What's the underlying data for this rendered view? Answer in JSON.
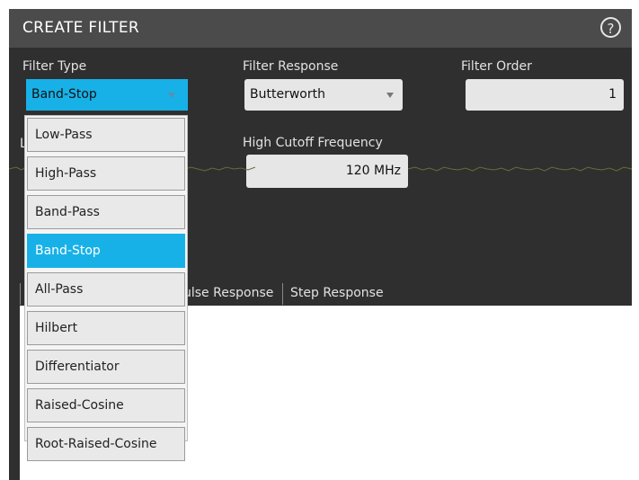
{
  "window": {
    "title": "CREATE FILTER",
    "help_icon": "?"
  },
  "filter_type": {
    "label": "Filter Type",
    "value": "Band-Stop"
  },
  "filter_response": {
    "label": "Filter Response",
    "value": "Butterworth"
  },
  "filter_order": {
    "label": "Filter Order",
    "value": "1"
  },
  "low_cutoff": {
    "label_partial": "L"
  },
  "high_cutoff": {
    "label": "High Cutoff Frequency",
    "value": "120 MHz"
  },
  "tabs": {
    "impulse_partial": "ulse Response",
    "step": "Step Response"
  },
  "dropdown_options": [
    "Low-Pass",
    "High-Pass",
    "Band-Pass",
    "Band-Stop",
    "All-Pass",
    "Hilbert",
    "Differentiator",
    "Raised-Cosine",
    "Root-Raised-Cosine"
  ],
  "selected_option": "Band-Stop",
  "colors": {
    "accent": "#17b1e7",
    "panel": "#2f2f2f",
    "titlebar": "#4b4b4b",
    "noise": "#6b6b3a"
  }
}
